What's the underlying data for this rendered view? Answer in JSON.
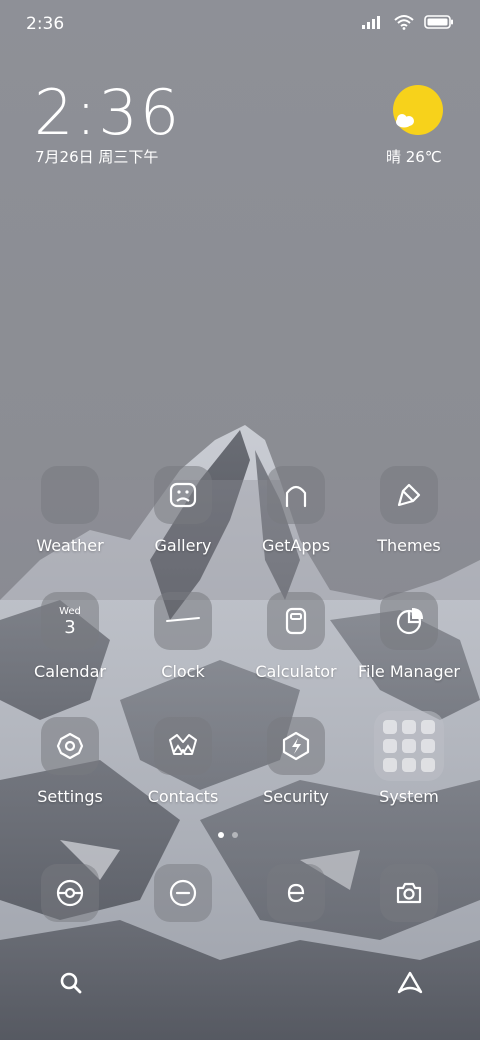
{
  "status_bar": {
    "time": "2:36"
  },
  "clock_widget": {
    "time": "2:36",
    "date": "7月26日 周三下午"
  },
  "weather_widget": {
    "text": "晴 26℃"
  },
  "apps": {
    "weather": "Weather",
    "gallery": "Gallery",
    "getapps": "GetApps",
    "themes": "Themes",
    "calendar": "Calendar",
    "calendar_weekday": "Wed",
    "calendar_day": "3",
    "clock": "Clock",
    "calculator": "Calculator",
    "file_manager": "File Manager",
    "settings": "Settings",
    "contacts": "Contacts",
    "security": "Security",
    "system": "System"
  },
  "page_indicator": {
    "current": 1,
    "total": 2
  },
  "icons": {
    "dock": [
      "phone-icon",
      "messages-icon",
      "browser-icon",
      "camera-icon"
    ],
    "bottom": [
      "search-icon",
      "assistant-icon"
    ]
  }
}
